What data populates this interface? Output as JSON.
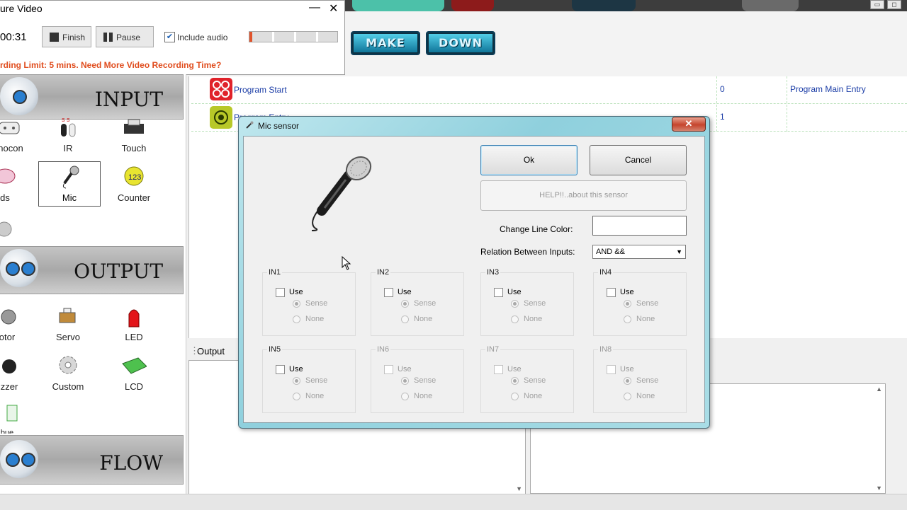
{
  "capture": {
    "title": "ure Video",
    "minimize": "—",
    "close": "✕",
    "elapsed": "00:31",
    "finish_label": "Finish",
    "pause_label": "Pause",
    "include_audio_label": "Include audio",
    "include_audio_checked": true,
    "progress_fraction": 0.03,
    "limit_text": "rding Limit: 5 mins. Need More Video Recording Time?"
  },
  "toolbar": {
    "make_label": "MAKE",
    "down_label": "DOWN"
  },
  "palette": {
    "sections": [
      "INPUT",
      "OUTPUT",
      "FLOW"
    ],
    "input_items": [
      "nocon",
      "IR",
      "Touch",
      "ds",
      "Mic",
      "Counter"
    ],
    "output_items": [
      "otor",
      "Servo",
      "LED",
      "zzer",
      "Custom",
      "LCD",
      "bue"
    ]
  },
  "program": {
    "rows": [
      {
        "name": "Program Start",
        "index": "0",
        "note": "Program Main Entry"
      },
      {
        "name": "Program Entry",
        "index": "1",
        "note": ""
      }
    ]
  },
  "output_panel": {
    "title": "Output"
  },
  "dialog": {
    "title": "Mic sensor",
    "close": "✕",
    "ok_label": "Ok",
    "cancel_label": "Cancel",
    "help_label": "HELP!!..about this sensor",
    "line_color_label": "Change Line Color:",
    "relation_label": "Relation Between Inputs:",
    "relation_value": "AND &&",
    "inputs": [
      {
        "name": "IN1",
        "use": "Use",
        "sense": "Sense",
        "none": "None",
        "enabled": true
      },
      {
        "name": "IN2",
        "use": "Use",
        "sense": "Sense",
        "none": "None",
        "enabled": true
      },
      {
        "name": "IN3",
        "use": "Use",
        "sense": "Sense",
        "none": "None",
        "enabled": true
      },
      {
        "name": "IN4",
        "use": "Use",
        "sense": "Sense",
        "none": "None",
        "enabled": true
      },
      {
        "name": "IN5",
        "use": "Use",
        "sense": "Sense",
        "none": "None",
        "enabled": true
      },
      {
        "name": "IN6",
        "use": "Use",
        "sense": "Sense",
        "none": "None",
        "enabled": false
      },
      {
        "name": "IN7",
        "use": "Use",
        "sense": "Sense",
        "none": "None",
        "enabled": false
      },
      {
        "name": "IN8",
        "use": "Use",
        "sense": "Sense",
        "none": "None",
        "enabled": false
      }
    ]
  },
  "colors": {
    "accent_red": "#e04c1d",
    "link_blue": "#1a3ca6",
    "dialog_frame": "#8fd0dd"
  }
}
